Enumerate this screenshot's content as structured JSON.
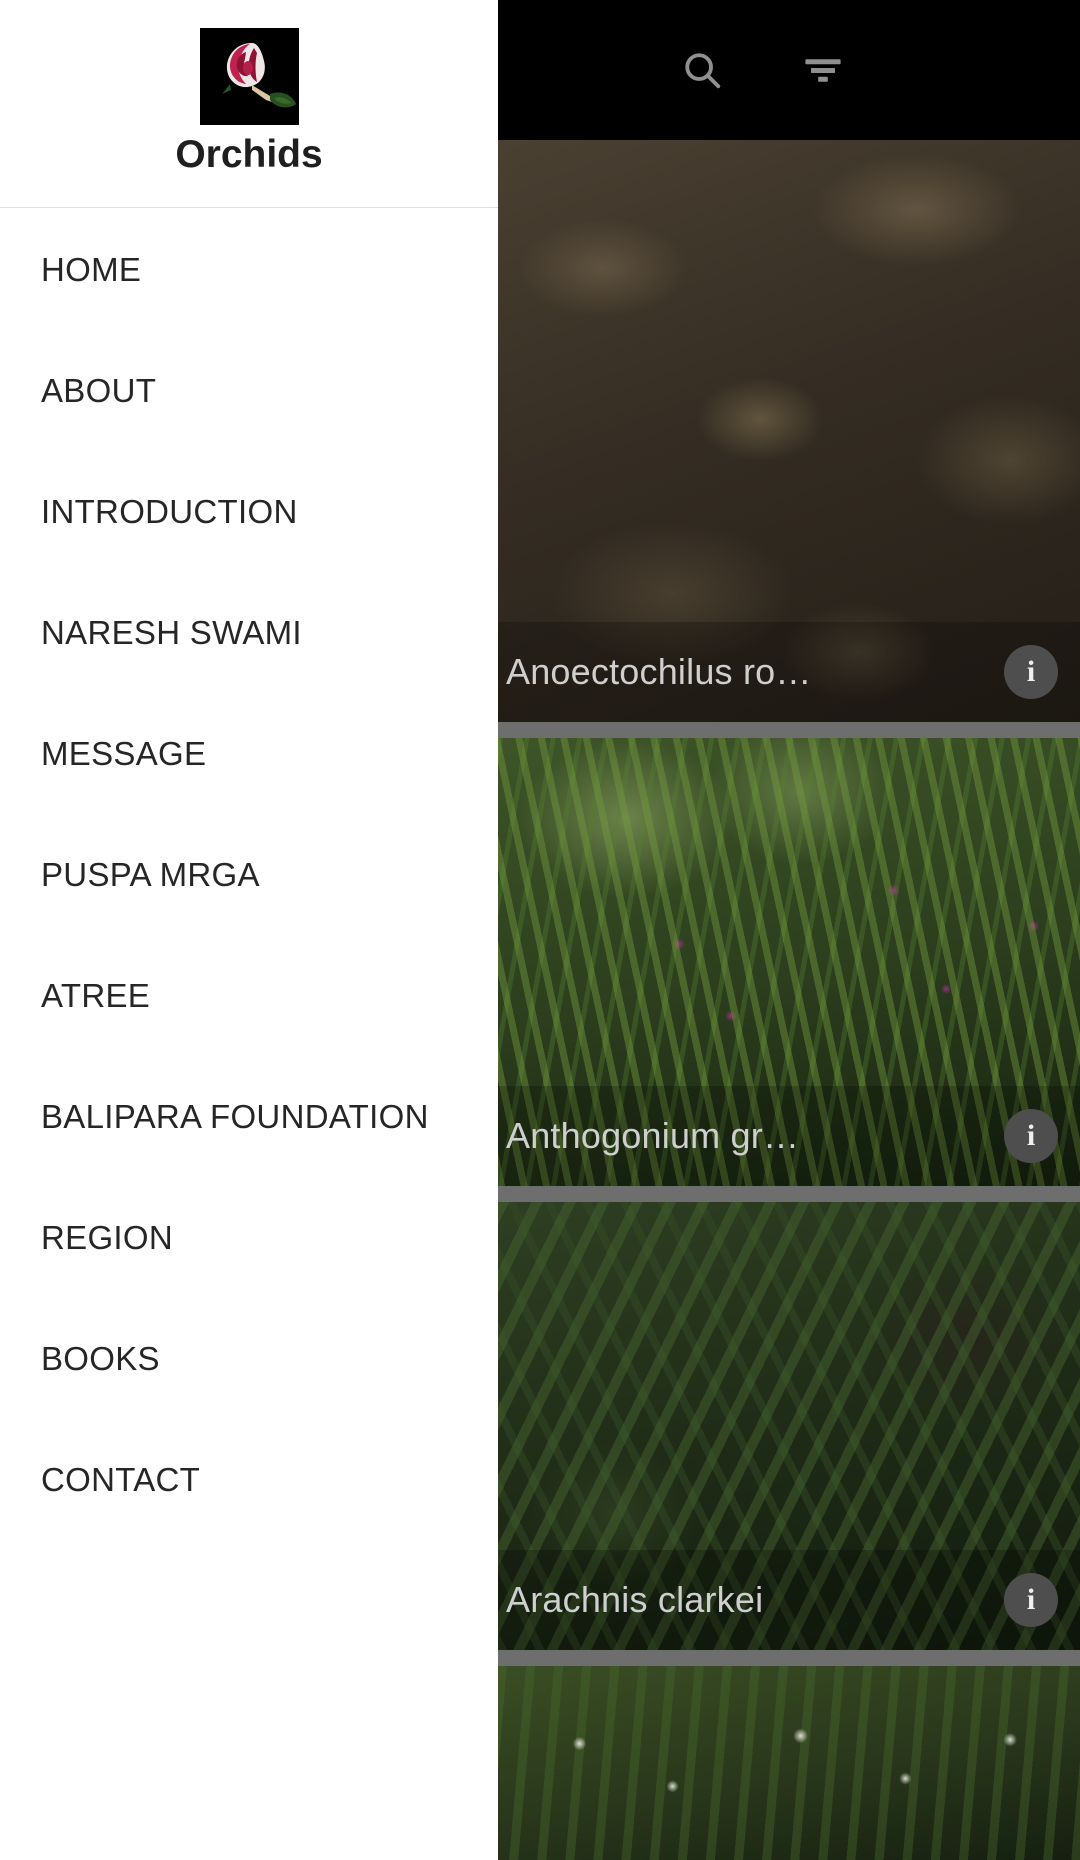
{
  "app": {
    "name": "Orchids",
    "drawer_title": "Orchids",
    "logo_icon": "orchid-flower-photo"
  },
  "appbar": {
    "search_icon": "search-icon",
    "search_label": "Search",
    "filter_icon": "filter-list-icon",
    "filter_label": "Filter"
  },
  "drawer": {
    "items": [
      {
        "label": "HOME"
      },
      {
        "label": "ABOUT"
      },
      {
        "label": "INTRODUCTION"
      },
      {
        "label": "NARESH SWAMI"
      },
      {
        "label": "MESSAGE"
      },
      {
        "label": "PUSPA MRGA"
      },
      {
        "label": "ATREE"
      },
      {
        "label": "BALIPARA FOUNDATION"
      },
      {
        "label": "REGION"
      },
      {
        "label": "BOOKS"
      },
      {
        "label": "CONTACT"
      }
    ]
  },
  "gallery": {
    "info_glyph": "i",
    "info_label": "info-icon",
    "cards": [
      {
        "caption": "Anoectochilus ro…",
        "photo": "forest-floor-orchid",
        "style": "ph-litter"
      },
      {
        "caption": "Anthogonium gr…",
        "photo": "grass-with-pink-flowers",
        "style": "ph-grass"
      },
      {
        "caption": "Arachnis clarkei",
        "photo": "dark-foliage-on-trunk",
        "style": "ph-leaves"
      },
      {
        "caption": "",
        "photo": "white-flowers-foliage",
        "style": "ph-white-fl"
      }
    ]
  },
  "colors": {
    "appbar_bg": "#000000",
    "drawer_bg": "#ffffff",
    "drawer_text": "#262626",
    "caption_text": "#cfcfcf",
    "separator": "#6e6e6e",
    "info_bg": "#4e4e4e",
    "icon_gray": "#909090"
  }
}
